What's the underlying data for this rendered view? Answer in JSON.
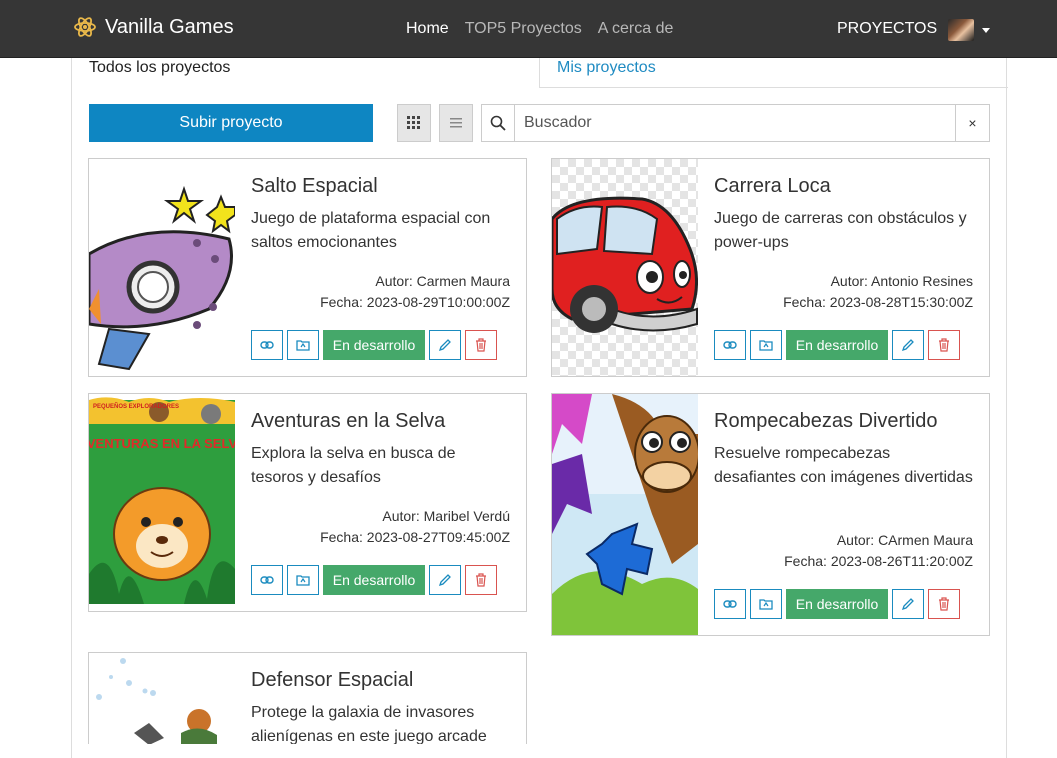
{
  "nav": {
    "brand": "Vanilla Games",
    "links": [
      "Home",
      "TOP5 Proyectos",
      "A cerca de"
    ],
    "projects": "PROYECTOS"
  },
  "tabs": {
    "all": "Todos los proyectos",
    "mine": "Mis proyectos"
  },
  "toolbar": {
    "upload": "Subir proyecto",
    "search_placeholder": "Buscador",
    "clear": "×"
  },
  "projects": [
    {
      "title": "Salto Espacial",
      "description": "Juego de plataforma espacial con saltos emocionantes",
      "author": "Autor: Carmen Maura",
      "date": "Fecha: 2023-08-29T10:00:00Z",
      "status": "En desarrollo"
    },
    {
      "title": "Carrera Loca",
      "description": "Juego de carreras con obstáculos y power-ups",
      "author": "Autor: Antonio Resines",
      "date": "Fecha: 2023-08-28T15:30:00Z",
      "status": "En desarrollo"
    },
    {
      "title": "Aventuras en la Selva",
      "description": "Explora la selva en busca de tesoros y desafíos",
      "author": "Autor: Maribel Verdú",
      "date": "Fecha: 2023-08-27T09:45:00Z",
      "status": "En desarrollo",
      "cover_text_top": "PEQUEÑOS EXPLORADORES",
      "cover_text": "AVENTURAS EN LA SELVA"
    },
    {
      "title": "Rompecabezas Divertido",
      "description": "Resuelve rompecabezas desafiantes con imágenes divertidas",
      "author": "Autor: CArmen Maura",
      "date": "Fecha: 2023-08-26T11:20:00Z",
      "status": "En desarrollo"
    },
    {
      "title": "Defensor Espacial",
      "description": "Protege la galaxia de invasores alienígenas en este juego arcade",
      "author": "",
      "date": "",
      "status": ""
    }
  ]
}
